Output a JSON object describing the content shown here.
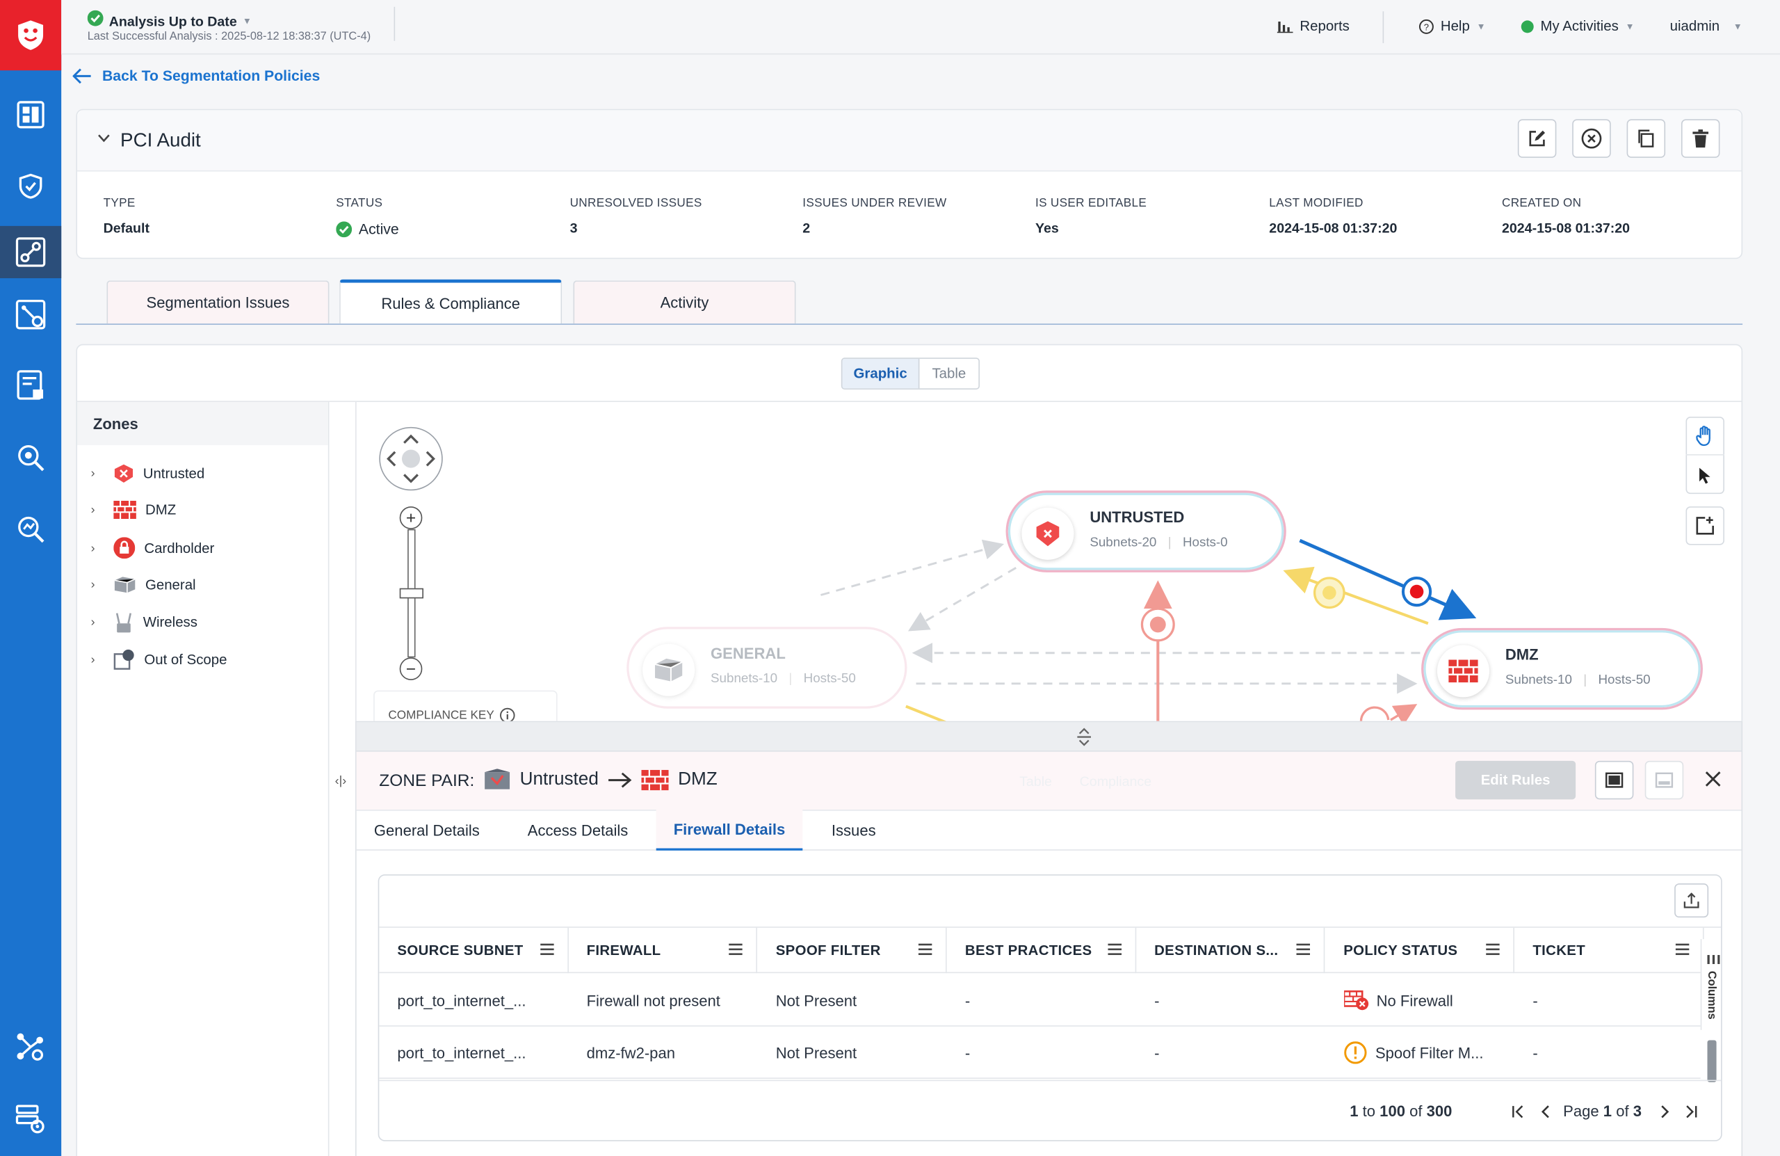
{
  "topbar": {
    "status_title": "Analysis Up to Date",
    "status_sub": "Last Successful Analysis : 2025-08-12 18:38:37 (UTC-4)",
    "reports": "Reports",
    "help": "Help",
    "activities": "My Activities",
    "user": "uiadmin"
  },
  "back_link": "Back To Segmentation Policies",
  "policy": {
    "title": "PCI Audit",
    "fields": [
      {
        "label": "TYPE",
        "value": "Default"
      },
      {
        "label": "STATUS",
        "value": "Active"
      },
      {
        "label": "UNRESOLVED ISSUES",
        "value": "3"
      },
      {
        "label": "ISSUES UNDER REVIEW",
        "value": "2"
      },
      {
        "label": "IS USER EDITABLE",
        "value": "Yes"
      },
      {
        "label": "LAST MODIFIED",
        "value": "2024-15-08 01:37:20"
      },
      {
        "label": "CREATED ON",
        "value": "2024-15-08 01:37:20"
      }
    ]
  },
  "tabs": [
    "Segmentation Issues",
    "Rules & Compliance",
    "Activity"
  ],
  "view_toggle": [
    "Graphic",
    "Table"
  ],
  "zones": {
    "title": "Zones",
    "items": [
      "Untrusted",
      "DMZ",
      "Cardholder",
      "General",
      "Wireless",
      "Out of Scope"
    ]
  },
  "compliance_key": "COMPLIANCE KEY",
  "graph": {
    "nodes": [
      {
        "title": "UNTRUSTED",
        "subnets": "Subnets-20",
        "hosts": "Hosts-0"
      },
      {
        "title": "GENERAL",
        "subnets": "Subnets-10",
        "hosts": "Hosts-50"
      },
      {
        "title": "DMZ",
        "subnets": "Subnets-10",
        "hosts": "Hosts-50"
      }
    ]
  },
  "panel": {
    "prefix": "ZONE PAIR:",
    "from": "Untrusted",
    "to": "DMZ",
    "edit_rules": "Edit Rules",
    "ghost_tabs": [
      "Table",
      "Compliance"
    ],
    "tabs": [
      "General Details",
      "Access Details",
      "Firewall Details",
      "Issues"
    ],
    "columns_label": "Columns",
    "table": {
      "headers": [
        "SOURCE SUBNET",
        "FIREWALL",
        "SPOOF FILTER",
        "BEST PRACTICES",
        "DESTINATION S...",
        "POLICY STATUS",
        "TICKET"
      ],
      "rows": [
        [
          "port_to_internet_...",
          "Firewall not present",
          "Not Present",
          "-",
          "-",
          "No Firewall",
          "-"
        ],
        [
          "port_to_internet_...",
          "dmz-fw2-pan",
          "Not Present",
          "-",
          "-",
          "Spoof Filter M...",
          "-"
        ]
      ]
    },
    "pagination": {
      "range_from": "1",
      "to_word": "to",
      "range_to": "100",
      "of_word": "of",
      "total": "300",
      "page_word": "Page",
      "page": "1",
      "pages": "3"
    }
  },
  "colors": {
    "nav": "#1b73cf",
    "nav_logo": "#e8222b",
    "accent": "#1b73cf",
    "danger": "#e53935",
    "warning": "#f29900"
  }
}
